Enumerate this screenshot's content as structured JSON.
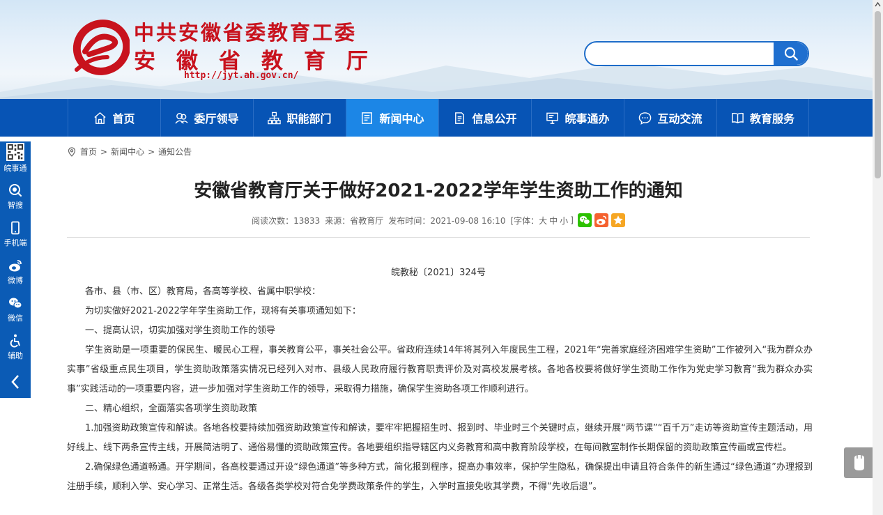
{
  "header": {
    "org_line1": "中共安徽省委教育工委",
    "org_line2": [
      "安",
      "徽",
      "省",
      "教",
      "育",
      "厅"
    ],
    "url": "http://jyt.ah.gov.cn/",
    "search_placeholder": "",
    "logo_icon": "e-logo-icon",
    "search_icon": "search-icon"
  },
  "nav": {
    "items": [
      {
        "label": "首页",
        "icon": "home-icon",
        "active": false
      },
      {
        "label": "委厅领导",
        "icon": "leaders-icon",
        "active": false
      },
      {
        "label": "职能部门",
        "icon": "org-chart-icon",
        "active": false
      },
      {
        "label": "新闻中心",
        "icon": "news-icon",
        "active": true
      },
      {
        "label": "信息公开",
        "icon": "document-icon",
        "active": false
      },
      {
        "label": "皖事通办",
        "icon": "monitor-icon",
        "active": false
      },
      {
        "label": "互动交流",
        "icon": "chat-icon",
        "active": false
      },
      {
        "label": "教育服务",
        "icon": "book-icon",
        "active": false
      }
    ]
  },
  "sidebar": {
    "items": [
      {
        "label": "皖事通",
        "icon": "qrcode-icon"
      },
      {
        "label": "智搜",
        "icon": "smart-search-icon"
      },
      {
        "label": "手机端",
        "icon": "mobile-icon"
      },
      {
        "label": "微博",
        "icon": "weibo-icon"
      },
      {
        "label": "微信",
        "icon": "wechat-icon"
      },
      {
        "label": "辅助",
        "icon": "accessibility-icon"
      }
    ],
    "collapse_icon": "chevron-left-icon"
  },
  "breadcrumb": {
    "icon": "location-icon",
    "home": "首页",
    "sep1": ">",
    "level1": "新闻中心",
    "sep2": ">",
    "level2": "通知公告"
  },
  "article": {
    "title": "安徽省教育厅关于做好2021-2022学年学生资助工作的通知",
    "meta": {
      "views": "阅读次数：13833",
      "source": "来源：省教育厅",
      "publish_time": "发布时间：2021-09-08 16:10",
      "font_label": "[字体：",
      "font_large": "大",
      "font_medium": "中",
      "font_small": "小",
      "font_close": "]"
    },
    "doc_no": "皖教秘〔2021〕324号",
    "paragraphs": [
      "各市、县（市、区）教育局，各高等学校、省属中职学校：",
      "为切实做好2021-2022学年学生资助工作，现将有关事项通知如下：",
      "一、提高认识，切实加强对学生资助工作的领导",
      "学生资助是一项重要的保民生、暖民心工程，事关教育公平，事关社会公平。省政府连续14年将其列入年度民生工程，2021年“完善家庭经济困难学生资助”工作被列入“我为群众办实事”省级重点民生项目，学生资助政策落实情况已经列入对市、县级人民政府履行教育职责评价及对高校发展考核。各地各校要将做好学生资助工作作为党史学习教育“我为群众办实事”实践活动的一项重要内容，进一步加强对学生资助工作的领导，采取得力措施，确保学生资助各项工作顺利进行。",
      "二、精心组织，全面落实各项学生资助政策",
      "1.加强资助政策宣传和解读。各地各校要持续加强资助政策宣传和解读，要牢牢把握招生时、报到时、毕业时三个关键时点，继续开展“两节课”“百千万”走访等资助宣传主题活动，用好线上、线下两条宣传主线，开展简洁明了、通俗易懂的资助政策宣传。各地要组织指导辖区内义务教育和高中教育阶段学校，在每间教室制作长期保留的资助政策宣传画或宣传栏。",
      "2.确保绿色通道畅通。开学期间，各高校要通过开设“绿色通道”等多种方式，简化报到程序，提高办事效率，保护学生隐私，确保提出申请且符合条件的新生通过“绿色通道”办理报到注册手续，顺利入学、安心学习、正常生活。各级各类学校对符合免学费政策条件的学生，入学时直接免收其学费，不得“先收后退”。"
    ]
  },
  "colors": {
    "nav_bg": "#0754b5",
    "nav_active": "#1c86e6",
    "logo_red": "#c8121d",
    "sidebar_bg": "#0b5bb5"
  }
}
